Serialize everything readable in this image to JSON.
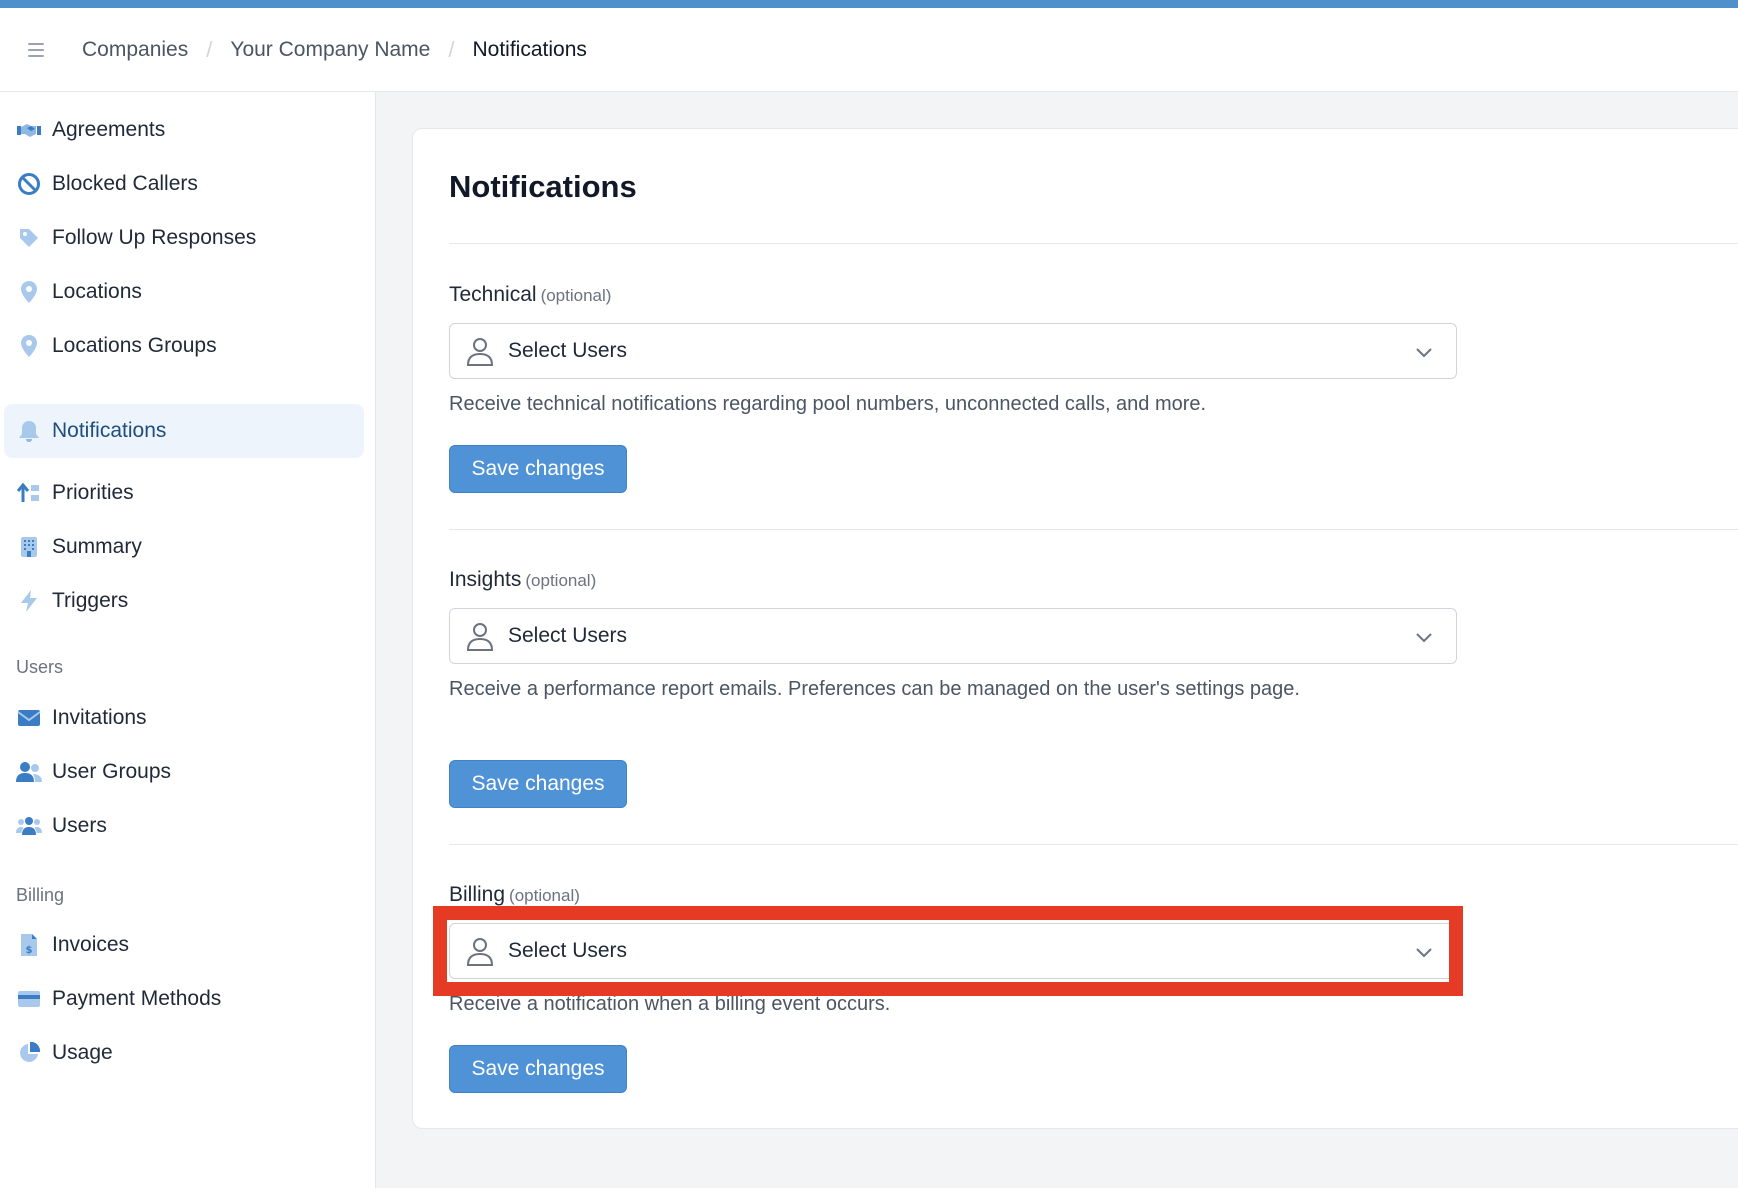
{
  "header": {
    "breadcrumb": [
      "Companies",
      "Your Company Name",
      "Notifications"
    ]
  },
  "sidebar": {
    "items": [
      {
        "label": "Agreements",
        "icon": "handshake-icon"
      },
      {
        "label": "Blocked Callers",
        "icon": "block-icon"
      },
      {
        "label": "Follow Up Responses",
        "icon": "tag-icon"
      },
      {
        "label": "Locations",
        "icon": "map-pin-icon"
      },
      {
        "label": "Locations Groups",
        "icon": "map-pin-icon"
      },
      {
        "label": "Notifications",
        "icon": "bell-icon",
        "active": true
      },
      {
        "label": "Priorities",
        "icon": "sort-icon"
      },
      {
        "label": "Summary",
        "icon": "building-icon"
      },
      {
        "label": "Triggers",
        "icon": "bolt-icon"
      }
    ],
    "users_section": {
      "label": "Users",
      "items": [
        {
          "label": "Invitations",
          "icon": "envelope-icon"
        },
        {
          "label": "User Groups",
          "icon": "user-group-icon"
        },
        {
          "label": "Users",
          "icon": "users-icon"
        }
      ]
    },
    "billing_section": {
      "label": "Billing",
      "items": [
        {
          "label": "Invoices",
          "icon": "invoice-icon"
        },
        {
          "label": "Payment Methods",
          "icon": "credit-card-icon"
        },
        {
          "label": "Usage",
          "icon": "pie-chart-icon"
        }
      ]
    }
  },
  "main": {
    "title": "Notifications",
    "sections": [
      {
        "label": "Technical",
        "optional": "(optional)",
        "select_placeholder": "Select Users",
        "help": "Receive technical notifications regarding pool numbers, unconnected calls, and more.",
        "button": "Save changes"
      },
      {
        "label": "Insights",
        "optional": "(optional)",
        "select_placeholder": "Select Users",
        "help": "Receive a performance report emails. Preferences can be managed on the user's settings page.",
        "button": "Save changes"
      },
      {
        "label": "Billing",
        "optional": "(optional)",
        "select_placeholder": "Select Users",
        "help": "Receive a notification when a billing event occurs.",
        "button": "Save changes"
      }
    ]
  },
  "colors": {
    "accent": "#4f93d6",
    "highlight": "#e53a23",
    "active_nav_bg": "#eef4fb"
  }
}
